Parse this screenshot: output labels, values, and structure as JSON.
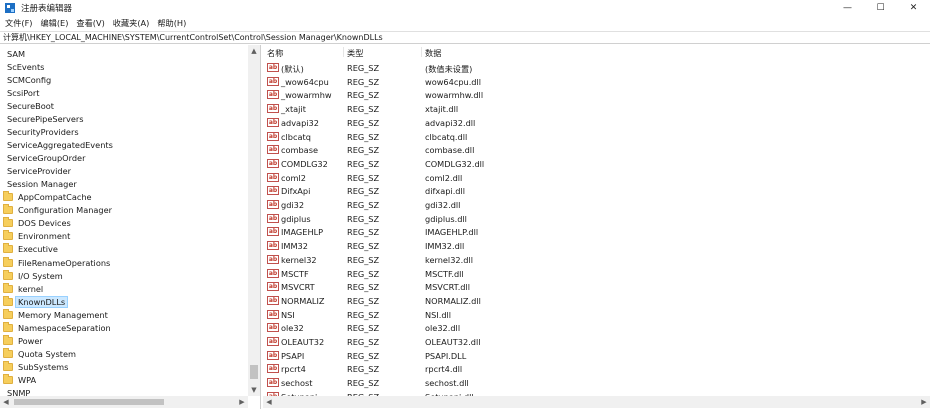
{
  "window": {
    "title": "注册表编辑器",
    "minimize": "—",
    "maximize": "☐",
    "close": "✕"
  },
  "menu": [
    "文件(F)",
    "编辑(E)",
    "查看(V)",
    "收藏夹(A)",
    "帮助(H)"
  ],
  "address": "计算机\\HKEY_LOCAL_MACHINE\\SYSTEM\\CurrentControlSet\\Control\\Session Manager\\KnownDLLs",
  "tree": {
    "items": [
      {
        "label": "SAM",
        "kind": "root"
      },
      {
        "label": "ScEvents",
        "kind": "root"
      },
      {
        "label": "SCMConfig",
        "kind": "root"
      },
      {
        "label": "ScsiPort",
        "kind": "root"
      },
      {
        "label": "SecureBoot",
        "kind": "root"
      },
      {
        "label": "SecurePipeServers",
        "kind": "root"
      },
      {
        "label": "SecurityProviders",
        "kind": "root"
      },
      {
        "label": "ServiceAggregatedEvents",
        "kind": "root"
      },
      {
        "label": "ServiceGroupOrder",
        "kind": "root"
      },
      {
        "label": "ServiceProvider",
        "kind": "root"
      },
      {
        "label": "Session Manager",
        "kind": "root"
      },
      {
        "label": "AppCompatCache",
        "kind": "child"
      },
      {
        "label": "Configuration Manager",
        "kind": "child"
      },
      {
        "label": "DOS Devices",
        "kind": "child"
      },
      {
        "label": "Environment",
        "kind": "child"
      },
      {
        "label": "Executive",
        "kind": "child"
      },
      {
        "label": "FileRenameOperations",
        "kind": "child"
      },
      {
        "label": "I/O System",
        "kind": "child"
      },
      {
        "label": "kernel",
        "kind": "child"
      },
      {
        "label": "KnownDLLs",
        "kind": "child",
        "selected": true
      },
      {
        "label": "Memory Management",
        "kind": "child"
      },
      {
        "label": "NamespaceSeparation",
        "kind": "child"
      },
      {
        "label": "Power",
        "kind": "child"
      },
      {
        "label": "Quota System",
        "kind": "child"
      },
      {
        "label": "SubSystems",
        "kind": "child"
      },
      {
        "label": "WPA",
        "kind": "child"
      },
      {
        "label": "SNMP",
        "kind": "root"
      }
    ]
  },
  "values": {
    "headers": {
      "name": "名称",
      "type": "类型",
      "data": "数据"
    },
    "icon_text": "ab",
    "rows": [
      {
        "name": "(默认)",
        "type": "REG_SZ",
        "data": "(数值未设置)"
      },
      {
        "name": "_wow64cpu",
        "type": "REG_SZ",
        "data": "wow64cpu.dll"
      },
      {
        "name": "_wowarmhw",
        "type": "REG_SZ",
        "data": "wowarmhw.dll"
      },
      {
        "name": "_xtajit",
        "type": "REG_SZ",
        "data": "xtajit.dll"
      },
      {
        "name": "advapi32",
        "type": "REG_SZ",
        "data": "advapi32.dll"
      },
      {
        "name": "clbcatq",
        "type": "REG_SZ",
        "data": "clbcatq.dll"
      },
      {
        "name": "combase",
        "type": "REG_SZ",
        "data": "combase.dll"
      },
      {
        "name": "COMDLG32",
        "type": "REG_SZ",
        "data": "COMDLG32.dll"
      },
      {
        "name": "coml2",
        "type": "REG_SZ",
        "data": "coml2.dll"
      },
      {
        "name": "DifxApi",
        "type": "REG_SZ",
        "data": "difxapi.dll"
      },
      {
        "name": "gdi32",
        "type": "REG_SZ",
        "data": "gdi32.dll"
      },
      {
        "name": "gdiplus",
        "type": "REG_SZ",
        "data": "gdiplus.dll"
      },
      {
        "name": "IMAGEHLP",
        "type": "REG_SZ",
        "data": "IMAGEHLP.dll"
      },
      {
        "name": "IMM32",
        "type": "REG_SZ",
        "data": "IMM32.dll"
      },
      {
        "name": "kernel32",
        "type": "REG_SZ",
        "data": "kernel32.dll"
      },
      {
        "name": "MSCTF",
        "type": "REG_SZ",
        "data": "MSCTF.dll"
      },
      {
        "name": "MSVCRT",
        "type": "REG_SZ",
        "data": "MSVCRT.dll"
      },
      {
        "name": "NORMALIZ",
        "type": "REG_SZ",
        "data": "NORMALIZ.dll"
      },
      {
        "name": "NSI",
        "type": "REG_SZ",
        "data": "NSI.dll"
      },
      {
        "name": "ole32",
        "type": "REG_SZ",
        "data": "ole32.dll"
      },
      {
        "name": "OLEAUT32",
        "type": "REG_SZ",
        "data": "OLEAUT32.dll"
      },
      {
        "name": "PSAPI",
        "type": "REG_SZ",
        "data": "PSAPI.DLL"
      },
      {
        "name": "rpcrt4",
        "type": "REG_SZ",
        "data": "rpcrt4.dll"
      },
      {
        "name": "sechost",
        "type": "REG_SZ",
        "data": "sechost.dll"
      },
      {
        "name": "Setupapi",
        "type": "REG_SZ",
        "data": "Setupapi.dll"
      }
    ]
  },
  "scroll": {
    "up": "▲",
    "down": "▼",
    "left": "◀",
    "right": "▶"
  },
  "colors": {
    "selection": "#cce8ff",
    "folder": "#f6ce5c",
    "string_icon": "#c0504d"
  }
}
